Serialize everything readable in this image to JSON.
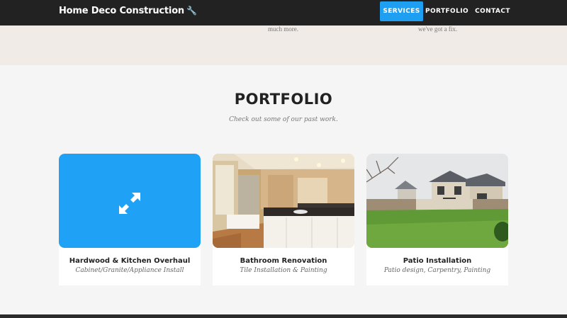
{
  "navbar": {
    "brand": "Home Deco Construction",
    "brand_icon": "wrench-icon",
    "items": [
      {
        "label": "SERVICES",
        "active": true
      },
      {
        "label": "PORTFOLIO",
        "active": false
      },
      {
        "label": "CONTACT",
        "active": false
      }
    ],
    "accent_color": "#1e9ff2",
    "background_color": "#222222"
  },
  "services": {
    "text_fragments": [
      "much more.",
      "we've got a fix."
    ]
  },
  "portfolio": {
    "title": "PORTFOLIO",
    "subtitle": "Check out some of our past work.",
    "items": [
      {
        "title": "Hardwood & Kitchen Overhaul",
        "caption": "Cabinet/Granite/Appliance Install",
        "image": "hover-overlay-expand-icon"
      },
      {
        "title": "Bathroom Renovation",
        "caption": "Tile Installation & Painting",
        "image": "bathroom-photo"
      },
      {
        "title": "Patio Installation",
        "caption": "Patio design, Carpentry, Painting",
        "image": "house-patio-photo"
      }
    ]
  }
}
